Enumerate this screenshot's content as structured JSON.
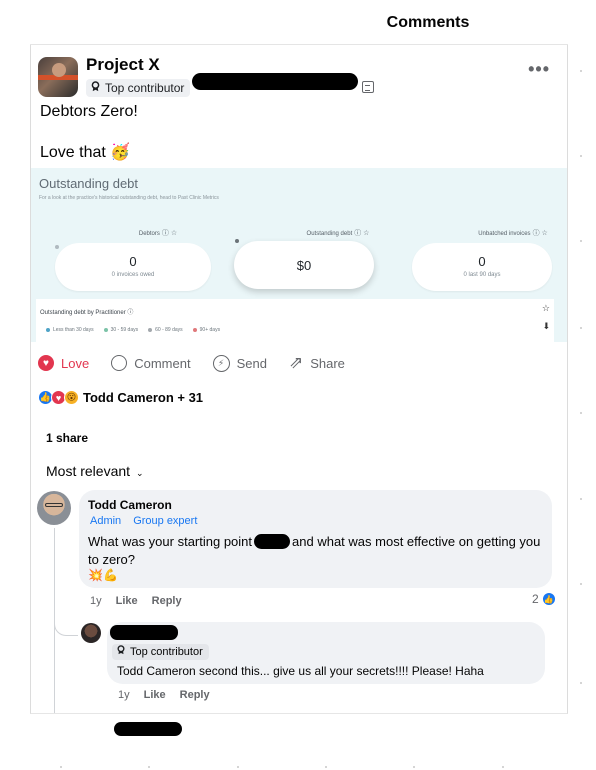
{
  "header": {
    "title": "Comments"
  },
  "post": {
    "author": "Project X",
    "badge": "Top contributor",
    "more_label": "•••",
    "line1": "Debtors Zero!",
    "line2": "Love that",
    "line2_emoji": "🥳"
  },
  "card": {
    "title": "Outstanding debt",
    "subtitle": "For a look at the practice's historical outstanding debt, head to Past Clinic Metrics",
    "metrics": [
      {
        "label": "Debtors",
        "value": "0",
        "note": "0 invoices owed"
      },
      {
        "label": "Outstanding debt",
        "value": "$0",
        "note": ""
      },
      {
        "label": "Unbatched invoices",
        "value": "0",
        "note": "0 last 90 days"
      }
    ],
    "by_practitioner": "Outstanding debt by Practitioner",
    "legend": [
      {
        "label": "Less than 30 days",
        "color": "#4fa3c7"
      },
      {
        "label": "30 - 59 days",
        "color": "#7cc3a8"
      },
      {
        "label": "60 - 89 days",
        "color": "#a3a8ad"
      },
      {
        "label": "90+ days",
        "color": "#e0787b"
      }
    ]
  },
  "actions": {
    "love": "Love",
    "comment": "Comment",
    "send": "Send",
    "share": "Share"
  },
  "reactions": {
    "text": "Todd Cameron + 31"
  },
  "shares": "1 share",
  "sort": {
    "label": "Most relevant",
    "chevron": "⌄"
  },
  "comments": [
    {
      "name": "Todd Cameron",
      "tags": [
        "Admin",
        "Group expert"
      ],
      "text_a": "What was your starting point",
      "text_b": "and what was most effective on getting you to zero?",
      "emoji": "💥💪",
      "time": "1y",
      "like": "Like",
      "reply": "Reply",
      "reaction_count": "2"
    },
    {
      "badge": "Top contributor",
      "text": "Todd Cameron second this... give us all your secrets!!!! Please! Haha",
      "time": "1y",
      "like": "Like",
      "reply": "Reply"
    }
  ]
}
